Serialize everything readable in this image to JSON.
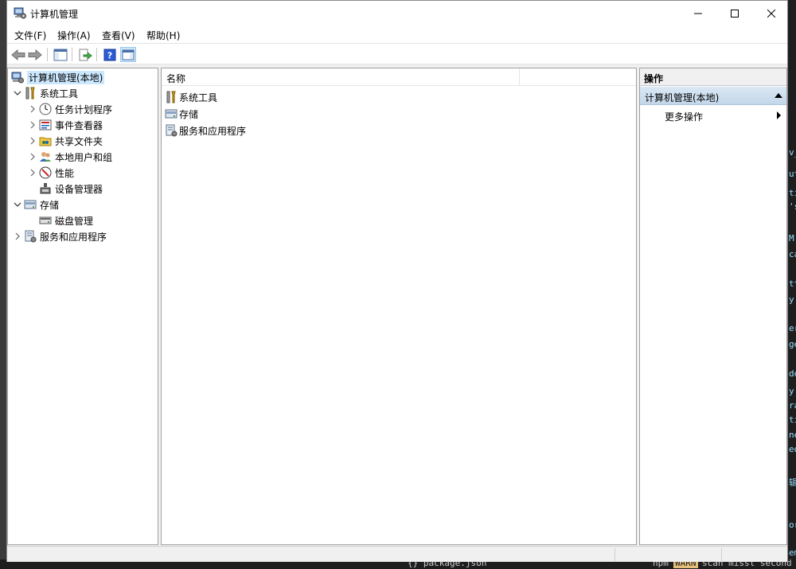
{
  "window": {
    "title": "计算机管理",
    "controls": {
      "minimize": "—",
      "maximize": "☐",
      "close": "✕"
    }
  },
  "menubar": {
    "items": [
      "文件(F)",
      "操作(A)",
      "查看(V)",
      "帮助(H)"
    ]
  },
  "toolbar": {
    "buttons": [
      "back-arrow-icon",
      "forward-arrow-icon",
      "show-hide-console-tree-icon",
      "export-list-icon",
      "help-icon",
      "show-hide-action-pane-icon"
    ]
  },
  "tree": {
    "root": "计算机管理(本地)",
    "items": [
      {
        "label": "系统工具",
        "level": 1,
        "expanded": true,
        "icon": "tools-icon"
      },
      {
        "label": "任务计划程序",
        "level": 2,
        "expanded": false,
        "icon": "clock-icon"
      },
      {
        "label": "事件查看器",
        "level": 2,
        "expanded": false,
        "icon": "event-viewer-icon"
      },
      {
        "label": "共享文件夹",
        "level": 2,
        "expanded": false,
        "icon": "shared-folder-icon"
      },
      {
        "label": "本地用户和组",
        "level": 2,
        "expanded": false,
        "icon": "users-icon"
      },
      {
        "label": "性能",
        "level": 2,
        "expanded": false,
        "icon": "performance-icon"
      },
      {
        "label": "设备管理器",
        "level": 2,
        "expanded": null,
        "icon": "device-manager-icon"
      },
      {
        "label": "存储",
        "level": 1,
        "expanded": true,
        "icon": "storage-icon"
      },
      {
        "label": "磁盘管理",
        "level": 2,
        "expanded": null,
        "icon": "disk-icon"
      },
      {
        "label": "服务和应用程序",
        "level": 1,
        "expanded": false,
        "icon": "services-icon"
      }
    ]
  },
  "list": {
    "column_header": "名称",
    "rows": [
      {
        "label": "系统工具",
        "icon": "tools-icon"
      },
      {
        "label": "存储",
        "icon": "storage-icon"
      },
      {
        "label": "服务和应用程序",
        "icon": "services-icon"
      }
    ]
  },
  "actions": {
    "title": "操作",
    "section": "计算机管理(本地)",
    "items": [
      "更多操作"
    ]
  },
  "background": {
    "bottom_text": "npm",
    "bottom_warn": "WARN",
    "bottom_text2": "scan missl second",
    "bottom_file": "{} package.json",
    "right_fragments": [
      "v_",
      "ut",
      "ti",
      "'s",
      "M",
      "ca",
      "tt",
      "y'",
      "er",
      "ge",
      "de",
      "y'",
      "ra",
      "ti",
      "ne",
      "ed",
      "辑",
      "or",
      "em"
    ]
  },
  "colors": {
    "selection": "#cce8ff",
    "action_section": "#c3d7ea",
    "pane_border": "#a0a0a0"
  }
}
